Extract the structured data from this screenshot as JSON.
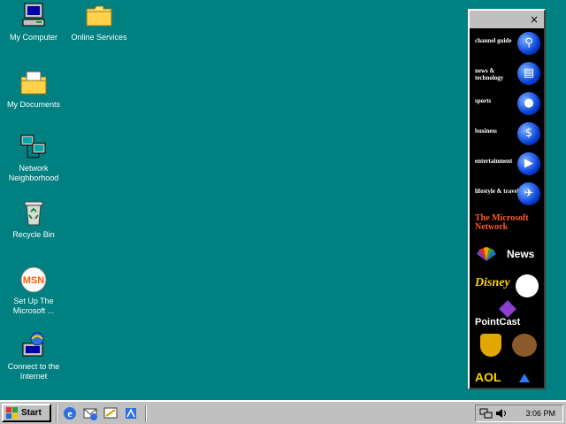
{
  "desktop": {
    "icons": [
      {
        "label": "My Computer"
      },
      {
        "label": "Online Services"
      },
      {
        "label": "My Documents"
      },
      {
        "label": "Network Neighborhood"
      },
      {
        "label": "Recycle Bin"
      },
      {
        "label": "Set Up The Microsoft ..."
      },
      {
        "label": "Connect to the Internet"
      }
    ],
    "background_color": "#008080"
  },
  "channel_bar": {
    "close_label": "×",
    "channels": [
      {
        "label": "channel guide",
        "icon": "magnifier-icon"
      },
      {
        "label": "news & technology",
        "icon": "newspaper-icon"
      },
      {
        "label": "sports",
        "icon": "ball-icon"
      },
      {
        "label": "business",
        "icon": "dollar-icon"
      },
      {
        "label": "entertainment",
        "icon": "film-icon"
      },
      {
        "label": "lifestyle & travel",
        "icon": "airplane-icon"
      }
    ],
    "brands": {
      "msn": "The Microsoft Network",
      "msnbc": "News",
      "disney": "Disney",
      "pointcast": "PointCast",
      "aol": "AOL"
    }
  },
  "taskbar": {
    "start_label": "Start",
    "clock": "3:06 PM"
  }
}
